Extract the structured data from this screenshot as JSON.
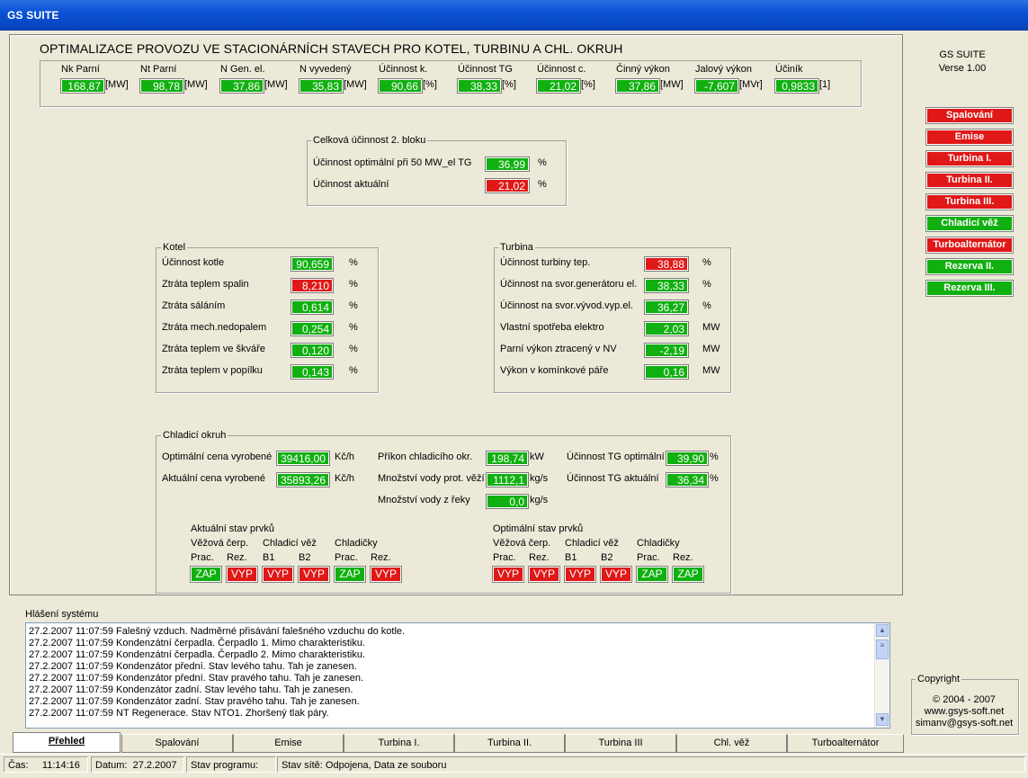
{
  "window": {
    "title": "GS SUITE"
  },
  "header": {
    "title": "OPTIMALIZACE PROVOZU VE STACIONÁRNÍCH STAVECH PRO KOTEL, TURBINU A CHL. OKRUH"
  },
  "top_metrics": [
    {
      "label": "Nk Parní",
      "value": "168,87",
      "unit": "[MW]",
      "color": "green"
    },
    {
      "label": "Nt Parní",
      "value": "98,78",
      "unit": "[MW]",
      "color": "green"
    },
    {
      "label": "N Gen. el.",
      "value": "37,86",
      "unit": "[MW]",
      "color": "green"
    },
    {
      "label": "N vyvedený",
      "value": "35,83",
      "unit": "[MW]",
      "color": "green"
    },
    {
      "label": "Účinnost k.",
      "value": "90,66",
      "unit": "[%]",
      "color": "green"
    },
    {
      "label": "Účinnost TG",
      "value": "38,33",
      "unit": "[%]",
      "color": "green"
    },
    {
      "label": "Účinnost c.",
      "value": "21,02",
      "unit": "[%]",
      "color": "green"
    },
    {
      "label": "Činný výkon",
      "value": "37,86",
      "unit": "[MW]",
      "color": "green"
    },
    {
      "label": "Jalový výkon",
      "value": "-7,607",
      "unit": "[MVr]",
      "color": "green"
    },
    {
      "label": "Účiník",
      "value": "0,9833",
      "unit": "[1]",
      "color": "green"
    }
  ],
  "celkova": {
    "title": "Celková účinnost 2. bloku",
    "rows": [
      {
        "label": "Účinnost optimální při 50 MW_el TG",
        "value": "36,99",
        "unit": "%",
        "color": "green"
      },
      {
        "label": "Účinnost aktuální",
        "value": "21,02",
        "unit": "%",
        "color": "red"
      }
    ]
  },
  "kotel": {
    "title": "Kotel",
    "rows": [
      {
        "label": "Účinnost kotle",
        "value": "90,659",
        "unit": "%",
        "color": "green"
      },
      {
        "label": "Ztráta teplem spalin",
        "value": "8,210",
        "unit": "%",
        "color": "red"
      },
      {
        "label": "Ztráta sáláním",
        "value": "0,614",
        "unit": "%",
        "color": "green"
      },
      {
        "label": "Ztráta mech.nedopalem",
        "value": "0,254",
        "unit": "%",
        "color": "green"
      },
      {
        "label": "Ztráta teplem ve škváře",
        "value": "0,120",
        "unit": "%",
        "color": "green"
      },
      {
        "label": "Ztráta teplem v popílku",
        "value": "0,143",
        "unit": "%",
        "color": "green"
      }
    ]
  },
  "turbina": {
    "title": "Turbina",
    "rows": [
      {
        "label": "Účinnost turbiny tep.",
        "value": "38,88",
        "unit": "%",
        "color": "red"
      },
      {
        "label": "Účinnost na svor.generátoru el.",
        "value": "38,33",
        "unit": "%",
        "color": "green"
      },
      {
        "label": "Účinnost na svor.vývod.vyp.el.",
        "value": "36,27",
        "unit": "%",
        "color": "green"
      },
      {
        "label": "Vlastní spotřeba elektro",
        "value": "2,03",
        "unit": "MW",
        "color": "green"
      },
      {
        "label": "Parní výkon ztracený v NV",
        "value": "-2,19",
        "unit": "MW",
        "color": "green"
      },
      {
        "label": "Výkon v komínkové páře",
        "value": "0,16",
        "unit": "MW",
        "color": "green"
      }
    ]
  },
  "chladici": {
    "title": "Chladicí  okruh",
    "col1": [
      {
        "label": "Optimální cena vyrobené",
        "value": "39416,00",
        "unit": "Kč/h"
      },
      {
        "label": "Aktuální cena vyrobené",
        "value": "35893,26",
        "unit": "Kč/h"
      }
    ],
    "col2": [
      {
        "label": "Příkon chladicího okr.",
        "value": "198,74",
        "unit": "kW"
      },
      {
        "label": "Množství vody prot. věží",
        "value": "1112,1",
        "unit": "kg/s"
      },
      {
        "label": "Množství vody z řeky",
        "value": "0,0",
        "unit": "kg/s"
      }
    ],
    "col3": [
      {
        "label": "Účinnost TG optimální",
        "value": "39,90",
        "unit": "%"
      },
      {
        "label": "Účinnost TG aktuální",
        "value": "36,34",
        "unit": "%"
      }
    ],
    "aktualni": {
      "title": "Aktuální stav prvků",
      "groups": [
        "Věžová čerp.",
        "Chladicí věž",
        "Chladičky"
      ],
      "sub": [
        "Prac.",
        "Rez.",
        "B1",
        "B2",
        "Prac.",
        "Rez."
      ],
      "states": [
        {
          "text": "ZAP",
          "color": "green"
        },
        {
          "text": "VYP",
          "color": "red"
        },
        {
          "text": "VYP",
          "color": "red"
        },
        {
          "text": "VYP",
          "color": "red"
        },
        {
          "text": "ZAP",
          "color": "green"
        },
        {
          "text": "VYP",
          "color": "red"
        }
      ]
    },
    "optimalni": {
      "title": "Optimální stav prvků",
      "groups": [
        "Věžová čerp.",
        "Chladicí věž",
        "Chladičky"
      ],
      "sub": [
        "Prac.",
        "Rez.",
        "B1",
        "B2",
        "Prac.",
        "Rez."
      ],
      "states": [
        {
          "text": "VYP",
          "color": "red"
        },
        {
          "text": "VYP",
          "color": "red"
        },
        {
          "text": "VYP",
          "color": "red"
        },
        {
          "text": "VYP",
          "color": "red"
        },
        {
          "text": "ZAP",
          "color": "green"
        },
        {
          "text": "ZAP",
          "color": "green"
        }
      ]
    }
  },
  "sidebar": {
    "app_name": "GS SUITE",
    "version": "Verse 1.00",
    "buttons": [
      {
        "label": "Spalování",
        "color": "red"
      },
      {
        "label": "Emise",
        "color": "red"
      },
      {
        "label": "Turbina I.",
        "color": "red"
      },
      {
        "label": "Turbina II.",
        "color": "red"
      },
      {
        "label": "Turbina III.",
        "color": "red"
      },
      {
        "label": "Chladicí věž",
        "color": "green"
      },
      {
        "label": "Turboalternátor",
        "color": "red"
      },
      {
        "label": "Rezerva II.",
        "color": "green"
      },
      {
        "label": "Rezerva III.",
        "color": "green"
      }
    ],
    "copyright": {
      "title": "Copyright",
      "lines": [
        "© 2004 - 2007",
        "www.gsys-soft.net",
        "simanv@gsys-soft.net"
      ]
    }
  },
  "log": {
    "title": "Hlášení systému",
    "lines": [
      "27.2.2007 11:07:59  Falešný vzduch. Nadměrné přisávání falešného vzduchu do kotle.",
      "27.2.2007 11:07:59  Kondenzátní čerpadla. Čerpadlo 1. Mimo charakteristiku.",
      "27.2.2007 11:07:59  Kondenzátní čerpadla. Čerpadlo 2. Mimo charakteristiku.",
      "27.2.2007 11:07:59  Kondenzátor přední. Stav levého tahu. Tah je zanesen.",
      "27.2.2007 11:07:59  Kondenzátor přední. Stav pravého tahu. Tah je zanesen.",
      "27.2.2007 11:07:59  Kondenzátor zadní. Stav levého tahu. Tah je zanesen.",
      "27.2.2007 11:07:59  Kondenzátor zadní. Stav pravého tahu. Tah je zanesen.",
      "27.2.2007 11:07:59  NT Regenerace. Stav NTO1.  Zhoršený tlak páry."
    ]
  },
  "tabs": [
    "Přehled",
    "Spalování",
    "Emise",
    "Turbina I.",
    "Turbina II.",
    "Turbina III",
    "Chl. věž",
    "Turboalternátor"
  ],
  "statusbar": {
    "time_label": "Čas:",
    "time": "11:14:16",
    "date_label": "Datum:",
    "date": "27.2.2007",
    "program_state": "Stav programu:",
    "network_state": "Stav sítě: Odpojena, Data ze souboru"
  }
}
